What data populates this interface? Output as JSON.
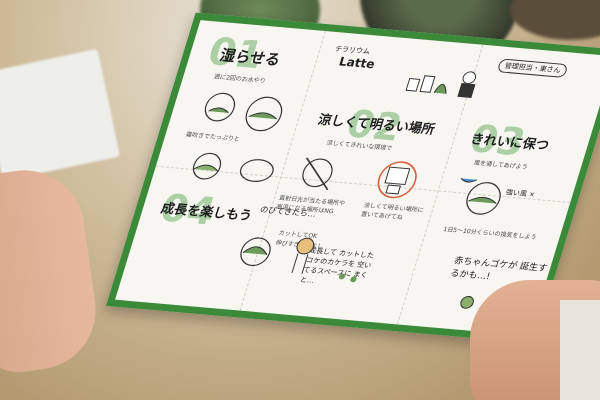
{
  "leaflet": {
    "brand": "テラリウム",
    "brand_sub": "Latte",
    "sections": [
      {
        "number": "01",
        "title": "湿らせる",
        "sub": "週に2回のお水やり"
      },
      {
        "number": "02",
        "title": "涼しくて明るい場所",
        "sub": "涼しくてきれいな環境で"
      },
      {
        "number": "03",
        "title": "きれいに保つ",
        "sub": "風を通してあげよう"
      },
      {
        "number": "04",
        "title": "成長を楽しもう",
        "sub": "のびてきたら…"
      }
    ],
    "notes": {
      "n1": "霧吹きでたっぷりと",
      "n2a": "直射日光が当たる場所や",
      "n2b": "高温になる場所はNG",
      "n2c": "涼しくて明るい場所に",
      "n2d": "置いてあげてね",
      "n3": "1日5〜10分くらいの換気をしよう",
      "tag": "管理担当・東さん",
      "wind": "強い風 ×",
      "grow1": "カットしてOK",
      "grow2": "伸びすぎてもよし",
      "grow3": "成長して カットしたコケのカケラを 空いてるスペースに まくと…",
      "baby": "赤ちゃんゴケが 誕生するかも…!"
    }
  }
}
